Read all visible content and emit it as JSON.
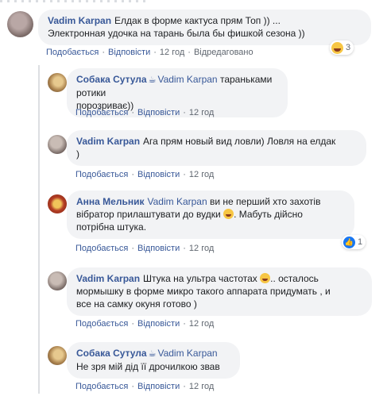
{
  "colors": {
    "link": "#385898",
    "bubble": "#f2f3f5",
    "meta": "#606770",
    "like_blue": "#1877f2"
  },
  "comments": [
    {
      "author": "Vadim Karpan",
      "line1": "Елдак в форме кактуса прям Топ )) ...",
      "line2": "Электронная удочка на тарань была бы фишкой сезона ))",
      "like": "Подобається",
      "reply": "Відповісти",
      "time": "12 год",
      "edited": "Відредаговано",
      "reaction_icon": "haha-emoji-icon",
      "reaction_count": "3"
    },
    {
      "author": "Собака Сутула",
      "cup": "☕",
      "mention": "Vadim Karpan",
      "line1": "тараньками ротики",
      "line2": "порозриває))",
      "like": "Подобається",
      "reply": "Відповісти",
      "time": "12 год"
    },
    {
      "author": "Vadim Karpan",
      "line1": "Ага прям новый вид ловли) Ловля на елдак",
      "line2": ")",
      "like": "Подобається",
      "reply": "Відповісти",
      "time": "12 год"
    },
    {
      "author": "Анна Мельник",
      "mention": "Vadim Karpan",
      "line1": "ви не перший хто захотів",
      "line2a": "вібратор прилаштувати до вудки",
      "line2b": ". Мабуть дійсно",
      "line3": "потрібна штука.",
      "like": "Подобається",
      "reply": "Відповісти",
      "time": "12 год",
      "reaction_icon": "like-icon",
      "reaction_count": "1"
    },
    {
      "author": "Vadim Karpan",
      "line1a": "Штука на ультра частотах",
      "line1b": ".. осталось",
      "line2": "мормышку в форме микро такого аппарата придумать , и",
      "line3": "все на самку окуня готово )",
      "like": "Подобається",
      "reply": "Відповісти",
      "time": "12 год"
    },
    {
      "author": "Собака Сутула",
      "cup": "☕",
      "mention": "Vadim Karpan",
      "line2": "Не зря мій дід її дрочилкою звав",
      "like": "Подобається",
      "reply": "Відповісти",
      "time": "12 год"
    }
  ]
}
